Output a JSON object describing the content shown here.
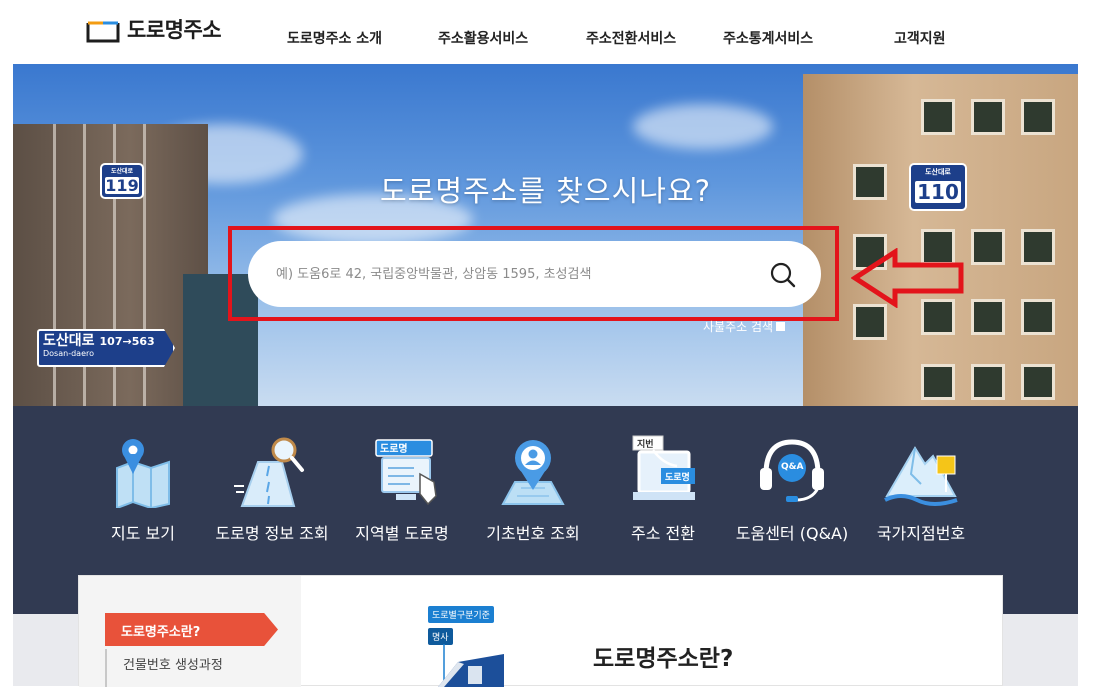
{
  "header": {
    "logo_text": "도로명주소",
    "nav": [
      "도로명주소 소개",
      "주소활용서비스",
      "주소전환서비스",
      "주소통계서비스",
      "고객지원"
    ]
  },
  "hero": {
    "title": "도로명주소를 찾으시나요?",
    "search_placeholder": "예) 도움6로 42, 국립중앙박물관, 상암동 1595, 초성검색",
    "sabal_label": "사불주소 검색",
    "signs": {
      "left_top_small": "도산대로",
      "left_top_num": "119",
      "left_big_name": "도산대로",
      "left_big_roman": "Dosan-daero",
      "left_big_range": "107→563",
      "right_small": "도산대로",
      "right_num": "110"
    }
  },
  "quick_menu": [
    {
      "label": "지도 보기",
      "icon": "map-icon"
    },
    {
      "label": "도로명 정보 조회",
      "icon": "road-search-icon"
    },
    {
      "label": "지역별 도로명",
      "icon": "region-select-icon"
    },
    {
      "label": "기초번호 조회",
      "icon": "location-pin-icon"
    },
    {
      "label": "주소 전환",
      "icon": "address-convert-icon"
    },
    {
      "label": "도움센터 (Q&A)",
      "icon": "headset-icon"
    },
    {
      "label": "국가지점번호",
      "icon": "mountain-marker-icon"
    }
  ],
  "quick_menu_extra": {
    "region_tag": "도로명",
    "convert_tag1": "지번",
    "convert_tag2": "도로명",
    "qa_tag": "Q&A"
  },
  "content": {
    "sidebar_active": "도로명주소란?",
    "sidebar_item": "건물번호 생성과정",
    "illus_tag1": "도로별구분기준",
    "illus_tag2": "명사",
    "title": "도로명주소란?"
  },
  "colors": {
    "accent_red": "#e3141b",
    "band": "#313a52",
    "side_active": "#e8523a"
  }
}
